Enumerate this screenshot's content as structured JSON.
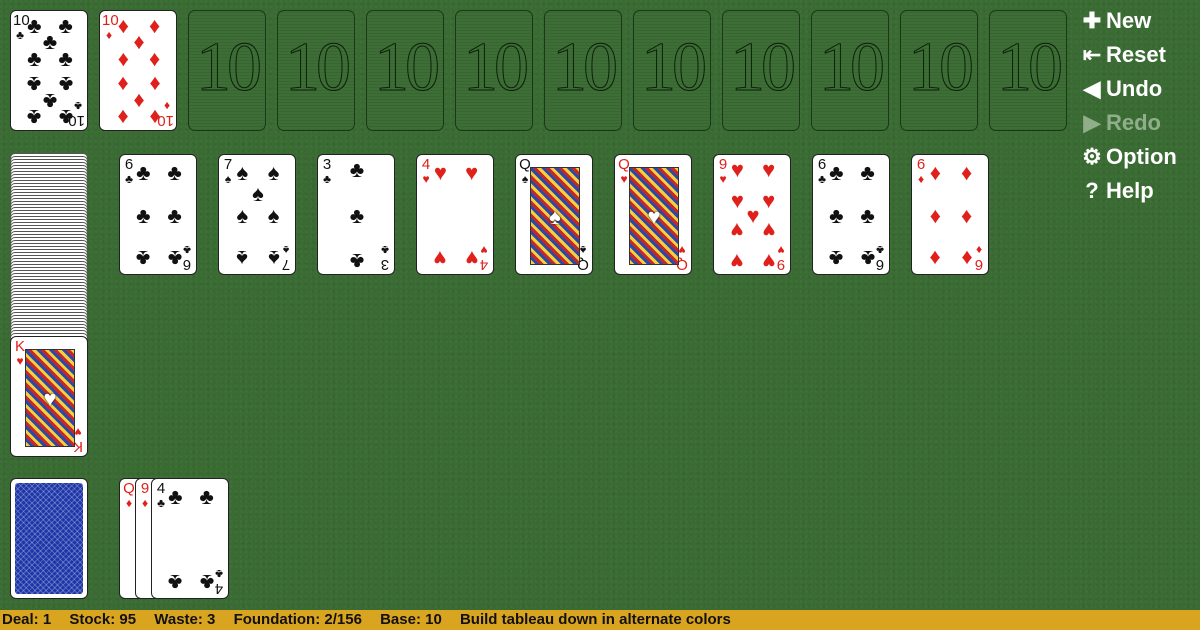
{
  "foundation_cards": [
    {
      "rank": "10",
      "suit": "♣",
      "color": "blk"
    },
    {
      "rank": "10",
      "suit": "♦",
      "color": "red"
    }
  ],
  "foundation_slot_label": "10",
  "stock_card": {
    "rank": "K",
    "suit": "♥",
    "color": "red"
  },
  "tableau": [
    {
      "rank": "6",
      "suit": "♣",
      "color": "blk"
    },
    {
      "rank": "7",
      "suit": "♠",
      "color": "blk"
    },
    {
      "rank": "3",
      "suit": "♣",
      "color": "blk"
    },
    {
      "rank": "4",
      "suit": "♥",
      "color": "red"
    },
    {
      "rank": "Q",
      "suit": "♠",
      "color": "blk"
    },
    {
      "rank": "Q",
      "suit": "♥",
      "color": "red"
    },
    {
      "rank": "9",
      "suit": "♥",
      "color": "red"
    },
    {
      "rank": "6",
      "suit": "♣",
      "color": "blk"
    },
    {
      "rank": "6",
      "suit": "♦",
      "color": "red"
    }
  ],
  "waste": [
    {
      "rank": "Q",
      "suit": "♦",
      "color": "red"
    },
    {
      "rank": "9",
      "suit": "♦",
      "color": "red"
    },
    {
      "rank": "4",
      "suit": "♣",
      "color": "blk"
    }
  ],
  "menu": {
    "new": "New",
    "reset": "Reset",
    "undo": "Undo",
    "redo": "Redo",
    "option": "Option",
    "help": "Help"
  },
  "status": {
    "deal": "Deal: 1",
    "stock": "Stock: 95",
    "waste": "Waste: 3",
    "foundation": "Foundation: 2/156",
    "base": "Base: 10",
    "hint": "Build tableau down in alternate colors"
  }
}
